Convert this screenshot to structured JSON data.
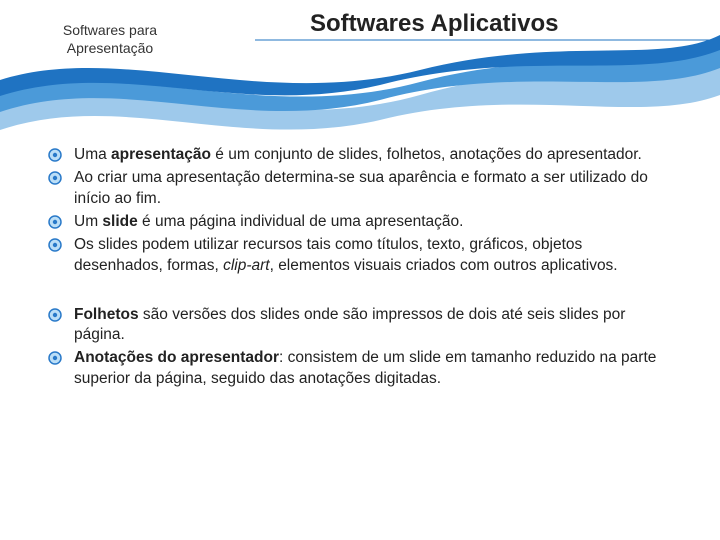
{
  "header": {
    "subtitle_line1": "Softwares para",
    "subtitle_line2": "Apresentação",
    "title": "Softwares Aplicativos"
  },
  "bullets_group1": [
    "Uma <b>apresentação</b> é um conjunto de slides, folhetos, anotações do apresentador.",
    "Ao criar uma apresentação determina-se sua aparência e formato a ser utilizado do início ao fim.",
    "Um <b>slide</b> é uma página individual de uma apresentação.",
    "Os slides podem utilizar recursos tais como títulos, texto, gráficos, objetos desenhados, formas, <i>clip-art</i>, elementos visuais criados com outros aplicativos."
  ],
  "bullets_group2": [
    "<b>Folhetos</b> são versões dos slides onde são impressos de dois até seis slides por página.",
    "<b>Anotações do apresentador</b>: consistem de um slide em tamanho reduzido na parte superior da página, seguido das anotações digitadas."
  ],
  "colors": {
    "wave_dark": "#1f73c2",
    "wave_mid": "#4b9ad9",
    "wave_light": "#9ec9eb",
    "bullet_outer": "#2a7ac9",
    "bullet_inner": "#bcdff7"
  }
}
